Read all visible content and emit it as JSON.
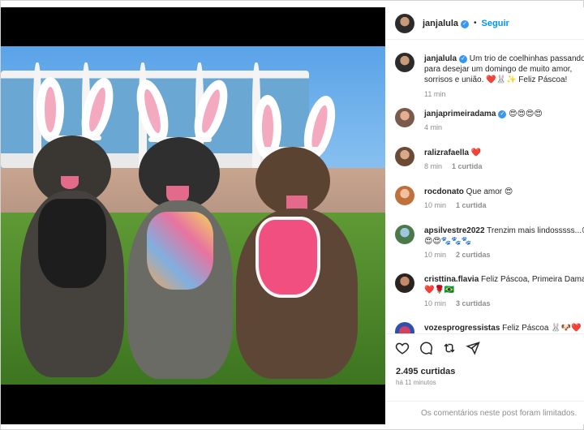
{
  "post": {
    "username": "janjalula",
    "follow_label": "Seguir",
    "separator": "•"
  },
  "caption": {
    "username": "janjalula",
    "text": "Um trio de coelhinhas passando para desejar um domingo de muito amor, sorrisos e união. ❤️🐰✨ Feliz Páscoa!",
    "time": "11 min"
  },
  "comments": [
    {
      "username": "janjaprimeiradama",
      "verified": true,
      "text": "😍😍😍😍",
      "time": "4 min",
      "likes": ""
    },
    {
      "username": "ralizrafaella",
      "verified": false,
      "text": "❤️",
      "time": "8 min",
      "likes": "1 curtida"
    },
    {
      "username": "rocdonato",
      "verified": false,
      "text": "Que amor 😍",
      "time": "10 min",
      "likes": "1 curtida"
    },
    {
      "username": "apsilvestre2022",
      "verified": false,
      "text": "Trenzim mais lindosssss...😍😍😍🐾🐾🐾",
      "time": "10 min",
      "likes": "2 curtidas"
    },
    {
      "username": "cristtina.flavia",
      "verified": false,
      "text": "Feliz Páscoa, Primeira Dama ❤️🌹🇧🇷",
      "time": "10 min",
      "likes": "3 curtidas"
    },
    {
      "username": "vozesprogressistas",
      "verified": false,
      "text": "Feliz Páscoa 🐰🐶❤️",
      "time": "",
      "likes": ""
    }
  ],
  "likes_count": "2.495 curtidas",
  "posted_ago": "há 11 minutos",
  "comments_limited": "Os comentários neste post foram limitados.",
  "icons": [
    "heart-icon",
    "comment-icon",
    "share-icon",
    "send-icon"
  ],
  "colors": {
    "follow": "#0095f6",
    "verified": "#3897f0",
    "muted": "#8e8e8e"
  }
}
